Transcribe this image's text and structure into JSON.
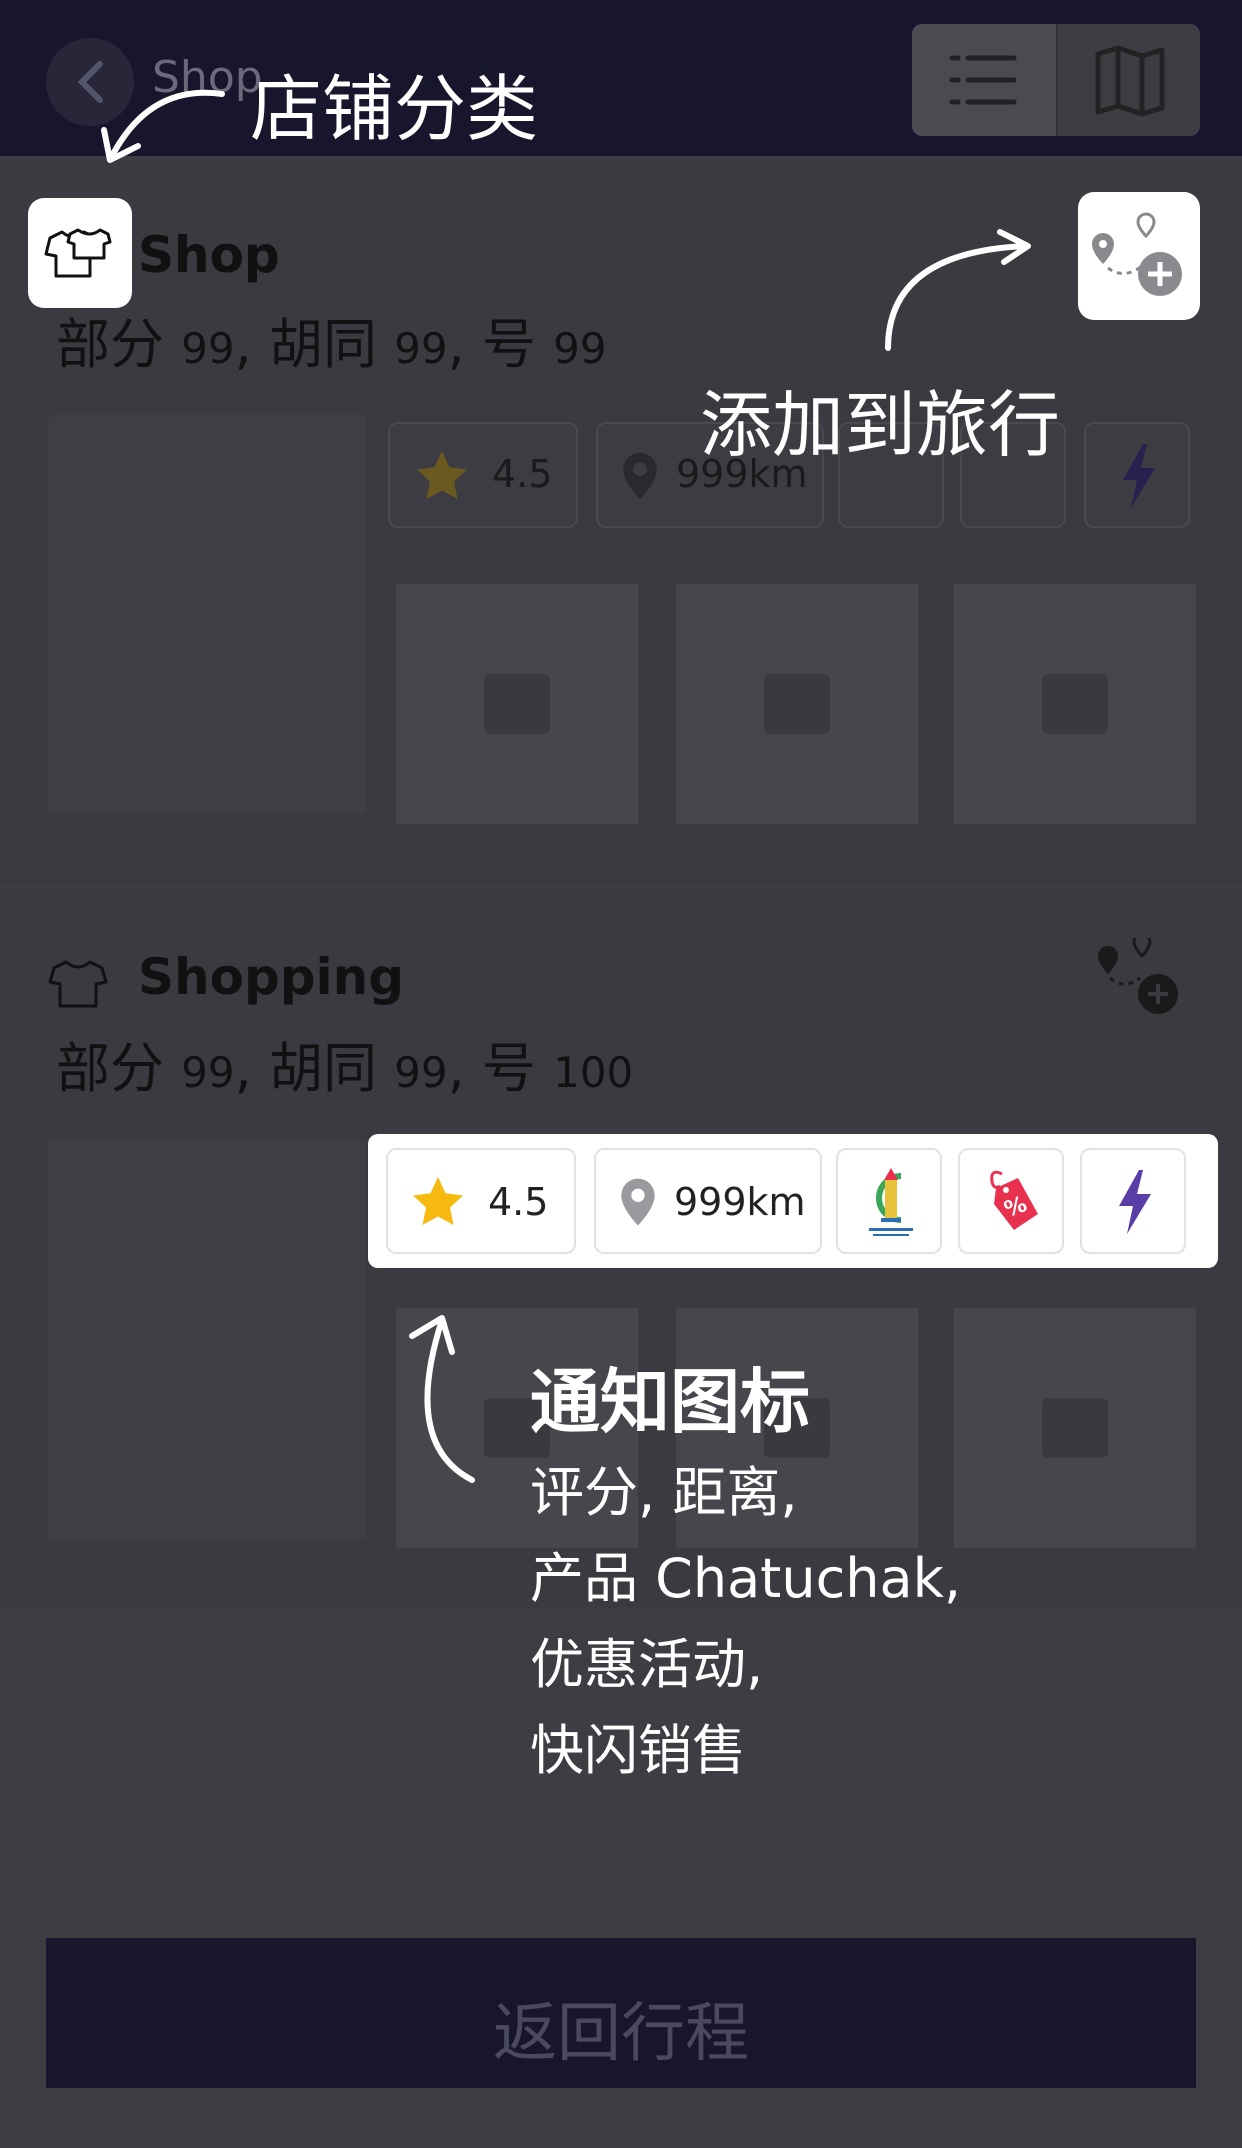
{
  "header": {
    "title": "Shop",
    "back_icon": "chevron-left-icon",
    "list_view_icon": "list-icon",
    "map_view_icon": "map-icon"
  },
  "shops": [
    {
      "name": "Shop",
      "address_parts": [
        "部分",
        "99",
        ", 胡同",
        "99",
        ", 号",
        "99"
      ],
      "rating": "4.5",
      "distance": "999km"
    },
    {
      "name": "Shopping",
      "address_parts": [
        "部分",
        "99",
        ", 胡同",
        "99",
        ", 号",
        "100"
      ],
      "rating": "4.5",
      "distance": "999km"
    }
  ],
  "annotations": {
    "category": "店铺分类",
    "add_to_trip": "添加到旅行",
    "notice_title": "通知图标",
    "notice_lines": [
      "评分, 距离,",
      "产品 Chatuchak,",
      "优惠活动,",
      "快闪销售"
    ]
  },
  "cta": {
    "label": "返回行程"
  },
  "colors": {
    "header_bg": "#17162c",
    "star": "#f5b90f",
    "sale_tag": "#e8314f",
    "flash": "#5b3da8"
  }
}
